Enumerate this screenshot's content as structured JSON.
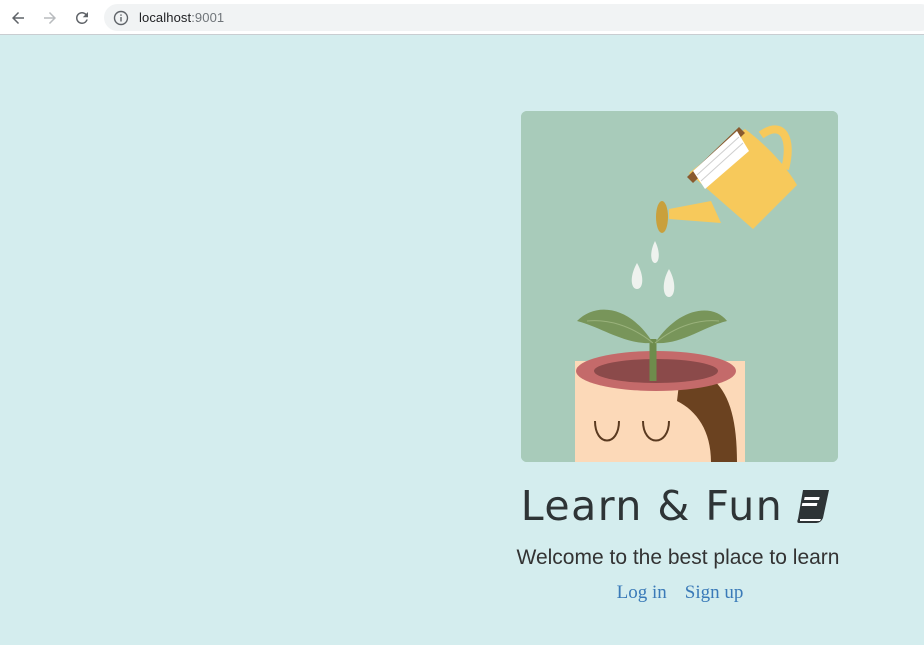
{
  "browser": {
    "url_host": "localhost",
    "url_port": ":9001",
    "icons": {
      "back": "arrow-left-icon",
      "forward": "arrow-right-icon",
      "reload": "reload-icon",
      "info": "info-icon"
    }
  },
  "page": {
    "hero_image": "watering-can-head-plant-illustration",
    "title": "Learn & Fun",
    "title_icon": "book-icon",
    "subtitle": "Welcome to the best place to learn",
    "links": {
      "login": "Log in",
      "signup": "Sign up"
    }
  },
  "colors": {
    "page_background": "#d4edee",
    "link": "#3a7ab8",
    "title": "#2e3436"
  }
}
